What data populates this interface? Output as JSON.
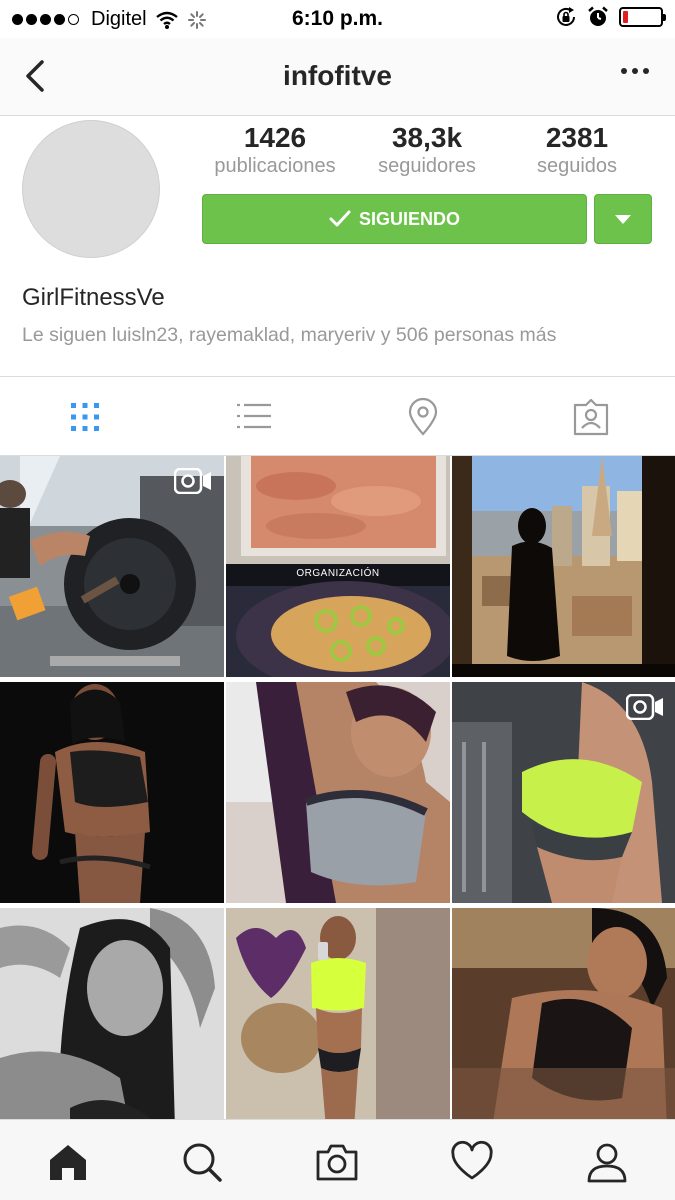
{
  "status_bar": {
    "carrier": "Digitel",
    "time": "6:10 p.m.",
    "battery_level": 0.15
  },
  "nav": {
    "title": "infofitve",
    "back_icon": "chevron-left-icon",
    "more_icon": "more-dots-icon"
  },
  "profile": {
    "stats": [
      {
        "value": "1426",
        "label": "publicaciones"
      },
      {
        "value": "38,3k",
        "label": "seguidores"
      },
      {
        "value": "2381",
        "label": "seguidos"
      }
    ],
    "follow_button": "SIGUIENDO",
    "name": "GirlFitnessVe",
    "followed_by": "Le siguen luisln23, rayemaklad, maryeriv y 506 personas más"
  },
  "view_tabs": [
    "grid-icon",
    "list-icon",
    "location-pin-icon",
    "tagged-icon"
  ],
  "grid": {
    "overlay_caption": "ORGANIZACIÓN",
    "video_badge_icon": "video-camera-icon"
  },
  "tabbar": [
    "home-icon",
    "search-icon",
    "camera-icon",
    "heart-icon",
    "profile-icon"
  ],
  "colors": {
    "follow_green": "#6cc24a",
    "active_tab_blue": "#3897f0",
    "battery_red": "#e02020"
  }
}
